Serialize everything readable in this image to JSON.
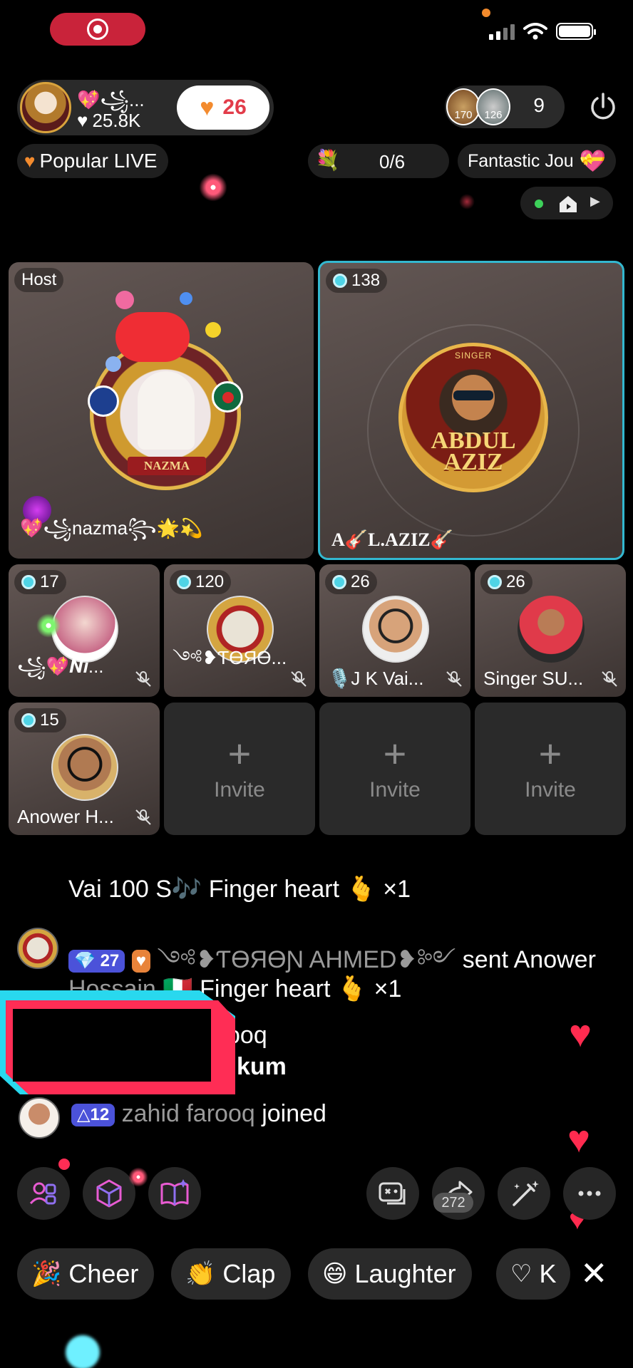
{
  "status_bar": {
    "recording": true
  },
  "host": {
    "name": "💖꧁...",
    "likes": "25.8K",
    "like_icon": "heart-icon",
    "follow_count": "26"
  },
  "viewers": {
    "avatar1_level": "170",
    "avatar2_level": "126",
    "count": "9"
  },
  "top_pills": {
    "popular": "Popular LIVE",
    "gift_goal": "0/6",
    "journey": "Fantastic Jou"
  },
  "tiles": {
    "host": {
      "tag": "Host",
      "name": "💖꧁nazma꧂🌟💫",
      "medal_text": "NAZMA"
    },
    "guest1": {
      "score": "138",
      "name": "A🎸L.AZIZ🎸",
      "medal_title": "ABDUL AZIZ",
      "medal_sub": "SINGER"
    },
    "small": [
      {
        "score": "17",
        "name": "꧁💖𝑵𝒊..."
      },
      {
        "score": "120",
        "name": "༺❥ƬӨЯӨ..."
      },
      {
        "score": "26",
        "name": "🎙️J K Vai..."
      },
      {
        "score": "26",
        "name": "Singer SU..."
      },
      {
        "score": "15",
        "name": "Anower H..."
      }
    ],
    "invite_label": "Invite"
  },
  "chat": {
    "line1": "Vai 100 S🎶 Finger heart 🫰 ×1",
    "line2_level": "27",
    "line2_user": "༺❥ƬӨЯӨƝ AHMED❥༻",
    "line2_action": "sent Anower",
    "line3_dim": "Hossain 🇮🇹",
    "line3": "Finger heart 🫰 ×1",
    "line4a": "ooq",
    "line4b": "kum",
    "line5_level": "12",
    "line5_user": "zahid farooq",
    "line5_action": "joined"
  },
  "toolbar": {
    "share_count": "272"
  },
  "reactions": [
    {
      "label": "Cheer",
      "icon": "party-popper-icon"
    },
    {
      "label": "Clap",
      "icon": "clap-icon"
    },
    {
      "label": "Laughter",
      "icon": "laugh-icon"
    },
    {
      "label": "K",
      "icon": "heart-outline-icon"
    }
  ],
  "colors": {
    "accent": "#33b8d0",
    "record": "#c9233a",
    "like": "#ff2b4f"
  }
}
